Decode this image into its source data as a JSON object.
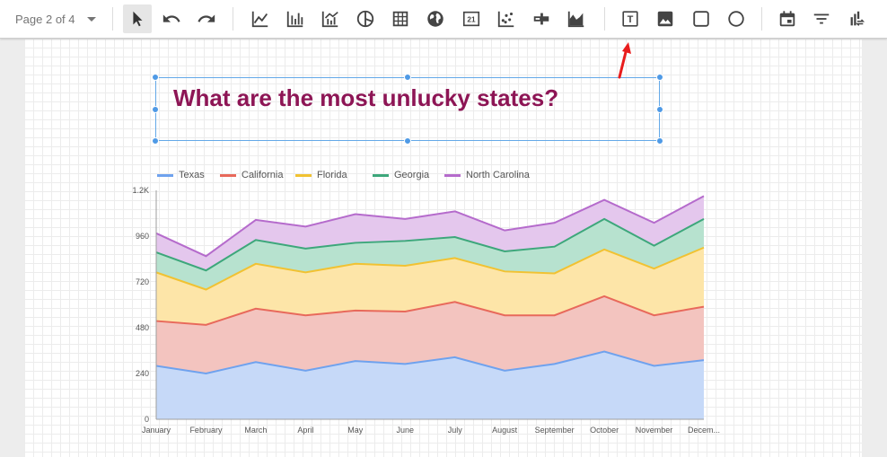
{
  "toolbar": {
    "page_indicator": "Page 2 of 4",
    "tools": [
      {
        "name": "select-icon",
        "label": "Select"
      },
      {
        "name": "undo-icon",
        "label": "Undo"
      },
      {
        "name": "redo-icon",
        "label": "Redo"
      },
      {
        "name": "line-chart-icon",
        "label": "Time series"
      },
      {
        "name": "bar-chart-icon",
        "label": "Bar chart"
      },
      {
        "name": "combo-chart-icon",
        "label": "Combo chart"
      },
      {
        "name": "pie-chart-icon",
        "label": "Pie chart"
      },
      {
        "name": "table-icon",
        "label": "Table"
      },
      {
        "name": "geo-map-icon",
        "label": "Geo map"
      },
      {
        "name": "scorecard-icon",
        "label": "Scorecard",
        "text": "21"
      },
      {
        "name": "scatter-chart-icon",
        "label": "Scatter chart"
      },
      {
        "name": "bullet-chart-icon",
        "label": "Bullet chart"
      },
      {
        "name": "area-chart-icon",
        "label": "Area chart"
      },
      {
        "name": "text-icon",
        "label": "Text",
        "text": "T"
      },
      {
        "name": "image-icon",
        "label": "Image"
      },
      {
        "name": "rectangle-icon",
        "label": "Rectangle"
      },
      {
        "name": "circle-icon",
        "label": "Circle"
      },
      {
        "name": "date-range-icon",
        "label": "Date range"
      },
      {
        "name": "filter-control-icon",
        "label": "Filter control"
      },
      {
        "name": "data-control-icon",
        "label": "Data control"
      }
    ]
  },
  "title_box": {
    "text": "What are the most unlucky states?",
    "color": "#8d1555"
  },
  "chart_data": {
    "type": "area",
    "stacked": true,
    "categories": [
      "January",
      "February",
      "March",
      "April",
      "May",
      "June",
      "July",
      "August",
      "September",
      "October",
      "November",
      "Decem..."
    ],
    "ylim": [
      0,
      1200
    ],
    "yticks": [
      "0",
      "240",
      "480",
      "720",
      "960",
      "1.2K"
    ],
    "legend_position": "top-left",
    "grid": false,
    "series": [
      {
        "name": "Texas",
        "color": "#6fa2ee",
        "fill": "#c6d9f8",
        "values": [
          280,
          240,
          300,
          255,
          305,
          290,
          325,
          255,
          290,
          355,
          280,
          310
        ]
      },
      {
        "name": "California",
        "color": "#e8695b",
        "fill": "#f3c4bf",
        "values": [
          235,
          255,
          280,
          290,
          265,
          275,
          290,
          290,
          255,
          290,
          265,
          280
        ]
      },
      {
        "name": "Florida",
        "color": "#f1c232",
        "fill": "#fde5a8",
        "values": [
          255,
          185,
          235,
          225,
          245,
          240,
          230,
          230,
          220,
          245,
          245,
          310
        ]
      },
      {
        "name": "Georgia",
        "color": "#3da77b",
        "fill": "#b7e2cf",
        "values": [
          105,
          100,
          125,
          125,
          110,
          130,
          110,
          105,
          140,
          160,
          120,
          150
        ]
      },
      {
        "name": "North Carolina",
        "color": "#b56bcc",
        "fill": "#e4c7ed",
        "values": [
          100,
          75,
          105,
          115,
          150,
          115,
          135,
          110,
          125,
          100,
          120,
          120
        ]
      }
    ]
  }
}
